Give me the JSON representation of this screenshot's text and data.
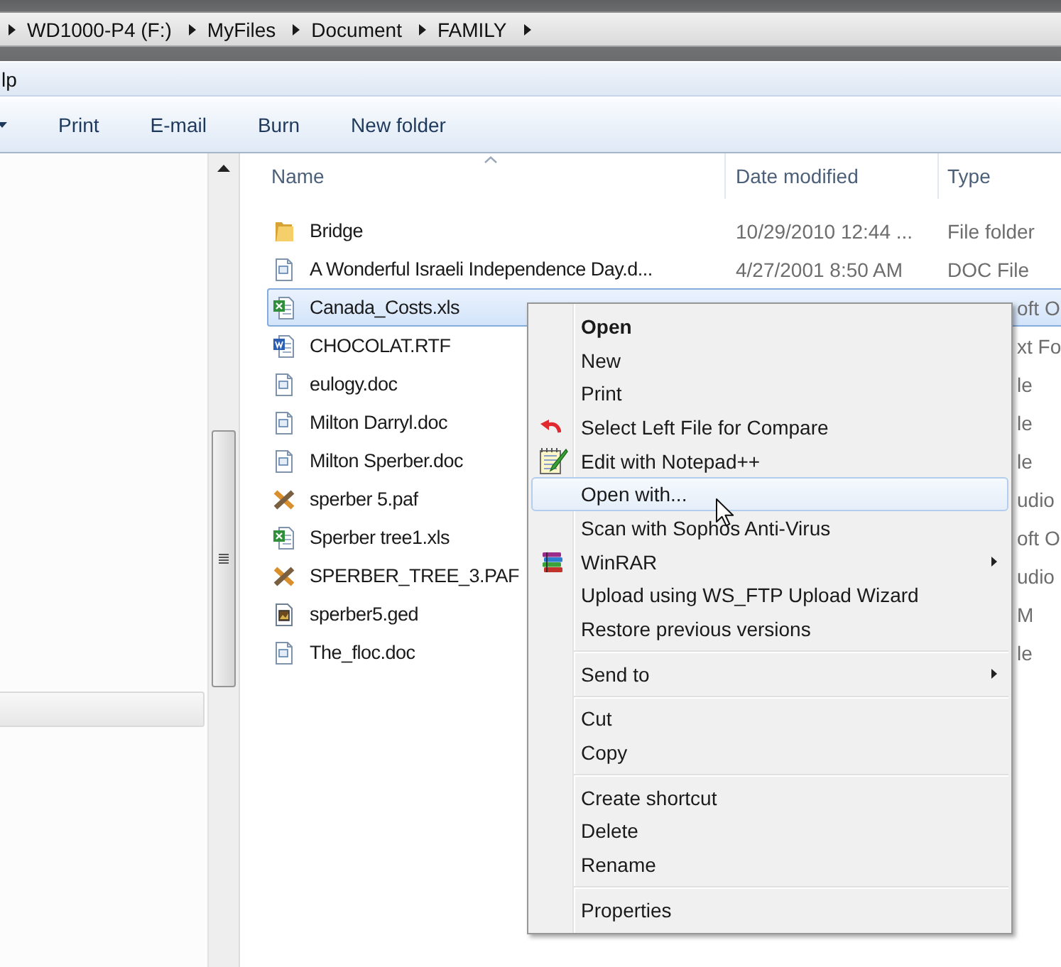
{
  "address_bar": {
    "segments": [
      "WD1000-P4 (F:)",
      "MyFiles",
      "Document",
      "FAMILY"
    ]
  },
  "menu_bar": {
    "items": [
      "lp"
    ]
  },
  "toolbar": {
    "buttons": [
      "Print",
      "E-mail",
      "Burn",
      "New folder"
    ]
  },
  "file_list": {
    "columns": [
      "Name",
      "Date modified",
      "Type"
    ],
    "rows": [
      {
        "kind": "folder",
        "name": "Bridge",
        "date": "10/29/2010 12:44 ...",
        "type": "File folder",
        "selected": false
      },
      {
        "kind": "document",
        "name": "A Wonderful Israeli Independence Day.d...",
        "date": "4/27/2001 8:50 AM",
        "type": "DOC File",
        "selected": false
      },
      {
        "kind": "spreadsheet",
        "name": "Canada_Costs.xls",
        "type_tail": "oft O",
        "selected": true
      },
      {
        "kind": "richtext",
        "name": "CHOCOLAT.RTF",
        "type_tail": "xt Fo",
        "selected": false
      },
      {
        "kind": "document",
        "name": "eulogy.doc",
        "type_tail": "le",
        "selected": false
      },
      {
        "kind": "document",
        "name": "Milton Darryl.doc",
        "type_tail": "le",
        "selected": false
      },
      {
        "kind": "document",
        "name": "Milton Sperber.doc",
        "type_tail": "le",
        "selected": false
      },
      {
        "kind": "family",
        "name": "sperber 5.paf",
        "type_tail": "udio",
        "selected": false
      },
      {
        "kind": "spreadsheet",
        "name": "Sperber tree1.xls",
        "type_tail": "oft O",
        "selected": false
      },
      {
        "kind": "family",
        "name": "SPERBER_TREE_3.PAF",
        "type_tail": "udio",
        "selected": false
      },
      {
        "kind": "gedcom",
        "name": "sperber5.ged",
        "type_tail": "M",
        "selected": false
      },
      {
        "kind": "document",
        "name": "The_floc.doc",
        "type_tail": "le",
        "selected": false
      }
    ]
  },
  "context_menu": {
    "groups": [
      [
        {
          "label": "Open",
          "kind": "plain",
          "default": true,
          "highlighted": false,
          "submenu": false
        },
        {
          "label": "New",
          "kind": "plain",
          "default": false,
          "highlighted": false,
          "submenu": false
        },
        {
          "label": "Print",
          "kind": "plain",
          "default": false,
          "highlighted": false,
          "submenu": false
        },
        {
          "label": "Select Left File for Compare",
          "kind": "compare",
          "default": false,
          "highlighted": false,
          "submenu": false
        },
        {
          "label": "Edit with Notepad++",
          "kind": "edit",
          "default": false,
          "highlighted": false,
          "submenu": false
        },
        {
          "label": "Open with...",
          "kind": "plain",
          "default": false,
          "highlighted": true,
          "submenu": false
        },
        {
          "label": "Scan with Sophos Anti-Virus",
          "kind": "plain",
          "default": false,
          "highlighted": false,
          "submenu": false
        },
        {
          "label": "WinRAR",
          "kind": "archive",
          "default": false,
          "highlighted": false,
          "submenu": true
        },
        {
          "label": "Upload using WS_FTP Upload Wizard",
          "kind": "plain",
          "default": false,
          "highlighted": false,
          "submenu": false
        },
        {
          "label": "Restore previous versions",
          "kind": "plain",
          "default": false,
          "highlighted": false,
          "submenu": false
        }
      ],
      [
        {
          "label": "Send to",
          "kind": "plain",
          "default": false,
          "highlighted": false,
          "submenu": true
        }
      ],
      [
        {
          "label": "Cut",
          "kind": "plain",
          "default": false,
          "highlighted": false,
          "submenu": false
        },
        {
          "label": "Copy",
          "kind": "plain",
          "default": false,
          "highlighted": false,
          "submenu": false
        }
      ],
      [
        {
          "label": "Create shortcut",
          "kind": "plain",
          "default": false,
          "highlighted": false,
          "submenu": false
        },
        {
          "label": "Delete",
          "kind": "plain",
          "default": false,
          "highlighted": false,
          "submenu": false
        },
        {
          "label": "Rename",
          "kind": "plain",
          "default": false,
          "highlighted": false,
          "submenu": false
        }
      ],
      [
        {
          "label": "Properties",
          "kind": "plain",
          "default": false,
          "highlighted": false,
          "submenu": false
        }
      ]
    ]
  }
}
